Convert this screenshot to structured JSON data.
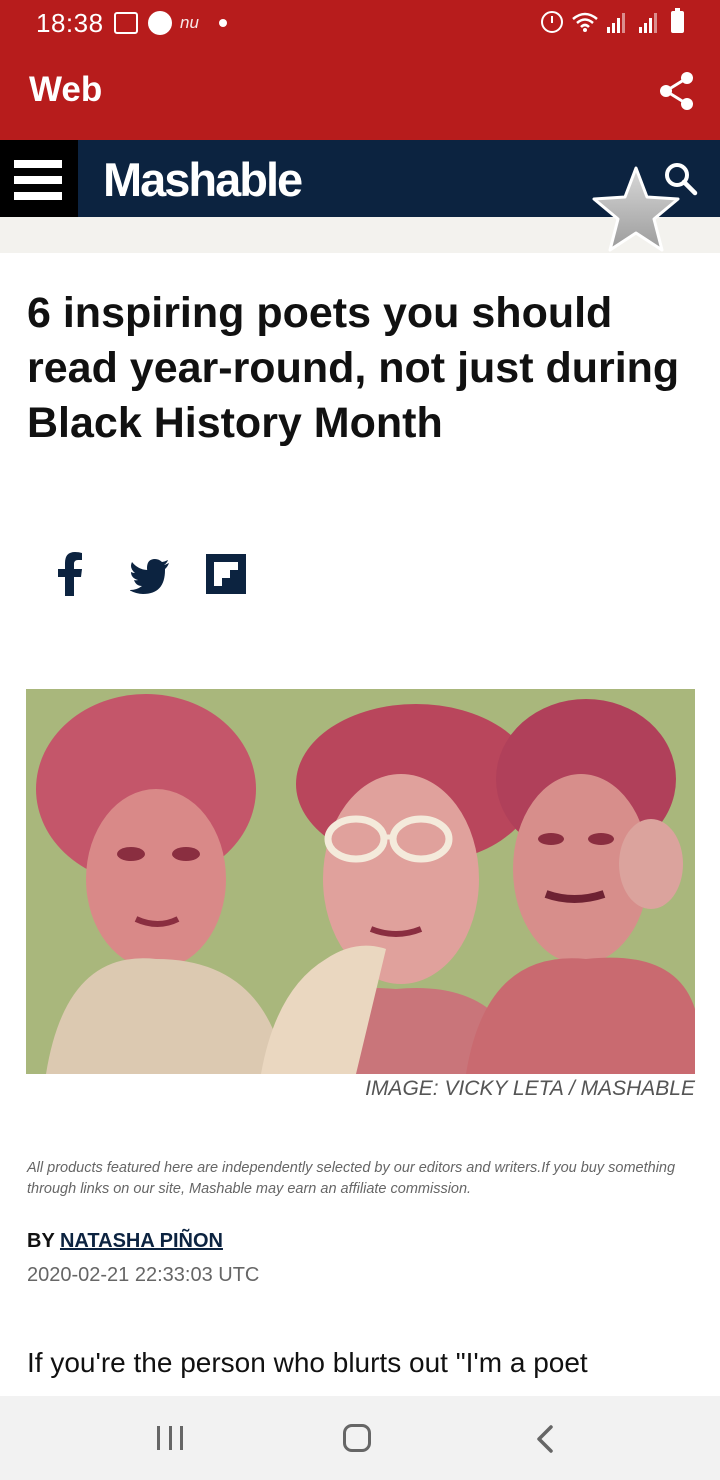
{
  "status_bar": {
    "time": "18:38",
    "left_icons": [
      "gallery-icon",
      "messenger-icon",
      "nu-app-icon",
      "notification-dot"
    ],
    "right_icons": [
      "alarm-icon",
      "wifi-icon",
      "signal-icon",
      "signal-icon",
      "battery-icon"
    ],
    "notification_text": "nu"
  },
  "app_bar": {
    "title": "Web",
    "share_icon": "share-icon",
    "color": "#b71c1c"
  },
  "site_nav": {
    "logo": "Mashable",
    "menu_icon": "hamburger-menu-icon",
    "search_icon": "search-icon",
    "bookmark_icon": "star-icon",
    "color": "#0c2340"
  },
  "article": {
    "headline": "6 inspiring poets you should read year-round, not just during Black History Month",
    "share_buttons": [
      "facebook-icon",
      "twitter-icon",
      "flipboard-icon"
    ],
    "image_caption": "IMAGE: VICKY LETA / MASHABLE",
    "disclaimer": "All products featured here are independently selected by our editors and writers.If you buy something through links on our site, Mashable may earn an affiliate commission.",
    "byline_prefix": "BY ",
    "author": "NATASHA PIÑON",
    "date": "2020-02-21 22:33:03 UTC",
    "body_start": "If you're the person who blurts out \"I'm a poet"
  },
  "nav_bar": {
    "icons": [
      "recents-icon",
      "home-icon",
      "back-icon"
    ]
  }
}
